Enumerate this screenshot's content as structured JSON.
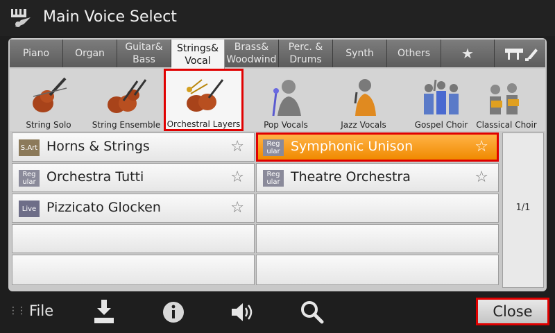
{
  "header": {
    "title": "Main Voice Select",
    "icon": "keyboard-icon"
  },
  "tabs": [
    {
      "label": "Piano"
    },
    {
      "label": "Organ"
    },
    {
      "label": "Guitar&\nBass"
    },
    {
      "label": "Strings&\nVocal",
      "active": true
    },
    {
      "label": "Brass&\nWoodwind"
    },
    {
      "label": "Perc. &\nDrums"
    },
    {
      "label": "Synth"
    },
    {
      "label": "Others"
    },
    {
      "label": "★",
      "icon": "favorite-star-icon"
    },
    {
      "label": "",
      "icon": "piano-expansion-icon"
    }
  ],
  "subcategories": [
    {
      "label": "String Solo",
      "icon": "violin-icon"
    },
    {
      "label": "String Ensemble",
      "icon": "violins-icon"
    },
    {
      "label": "Orchestral Layers",
      "icon": "orchestra-icon",
      "selected": true
    },
    {
      "label": "Pop Vocals",
      "icon": "microphone-singer-icon"
    },
    {
      "label": "Jazz Vocals",
      "icon": "jazz-singer-icon"
    },
    {
      "label": "Gospel Choir",
      "icon": "gospel-choir-icon"
    },
    {
      "label": "Classical Choir",
      "icon": "classical-choir-icon"
    }
  ],
  "voices_left": [
    {
      "badge": "S.Art",
      "badge_color": "#8c7a5a",
      "name": "Horns & Strings"
    },
    {
      "badge": "Reg\nular",
      "badge_color": "#8a8a9a",
      "name": "Orchestra Tutti"
    },
    {
      "badge": "Live",
      "badge_color": "#6e6e88",
      "name": "Pizzicato Glocken"
    },
    {
      "badge": "",
      "name": ""
    },
    {
      "badge": "",
      "name": ""
    }
  ],
  "voices_right": [
    {
      "badge": "Reg\nular",
      "badge_color": "#8a8a9a",
      "name": "Symphonic Unison",
      "selected": true
    },
    {
      "badge": "Reg\nular",
      "badge_color": "#8a8a9a",
      "name": "Theatre Orchestra"
    },
    {
      "badge": "",
      "name": ""
    },
    {
      "badge": "",
      "name": ""
    },
    {
      "badge": "",
      "name": ""
    }
  ],
  "pager": {
    "text": "1/1"
  },
  "bottom": {
    "file_label": "File",
    "close_label": "Close",
    "icons": [
      "save-icon",
      "info-icon",
      "speaker-icon",
      "search-icon"
    ]
  },
  "colors": {
    "accent_orange": "#f5a623",
    "highlight_red": "#e00000"
  }
}
